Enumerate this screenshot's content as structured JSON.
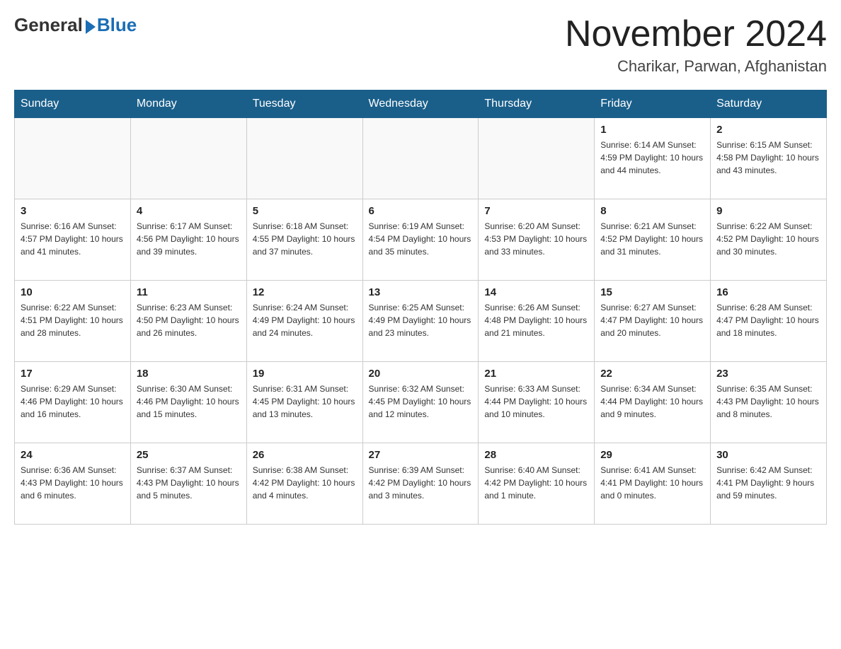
{
  "header": {
    "logo_general": "General",
    "logo_blue": "Blue",
    "month_title": "November 2024",
    "location": "Charikar, Parwan, Afghanistan"
  },
  "weekdays": [
    "Sunday",
    "Monday",
    "Tuesday",
    "Wednesday",
    "Thursday",
    "Friday",
    "Saturday"
  ],
  "weeks": [
    [
      {
        "day": "",
        "info": ""
      },
      {
        "day": "",
        "info": ""
      },
      {
        "day": "",
        "info": ""
      },
      {
        "day": "",
        "info": ""
      },
      {
        "day": "",
        "info": ""
      },
      {
        "day": "1",
        "info": "Sunrise: 6:14 AM\nSunset: 4:59 PM\nDaylight: 10 hours and 44 minutes."
      },
      {
        "day": "2",
        "info": "Sunrise: 6:15 AM\nSunset: 4:58 PM\nDaylight: 10 hours and 43 minutes."
      }
    ],
    [
      {
        "day": "3",
        "info": "Sunrise: 6:16 AM\nSunset: 4:57 PM\nDaylight: 10 hours and 41 minutes."
      },
      {
        "day": "4",
        "info": "Sunrise: 6:17 AM\nSunset: 4:56 PM\nDaylight: 10 hours and 39 minutes."
      },
      {
        "day": "5",
        "info": "Sunrise: 6:18 AM\nSunset: 4:55 PM\nDaylight: 10 hours and 37 minutes."
      },
      {
        "day": "6",
        "info": "Sunrise: 6:19 AM\nSunset: 4:54 PM\nDaylight: 10 hours and 35 minutes."
      },
      {
        "day": "7",
        "info": "Sunrise: 6:20 AM\nSunset: 4:53 PM\nDaylight: 10 hours and 33 minutes."
      },
      {
        "day": "8",
        "info": "Sunrise: 6:21 AM\nSunset: 4:52 PM\nDaylight: 10 hours and 31 minutes."
      },
      {
        "day": "9",
        "info": "Sunrise: 6:22 AM\nSunset: 4:52 PM\nDaylight: 10 hours and 30 minutes."
      }
    ],
    [
      {
        "day": "10",
        "info": "Sunrise: 6:22 AM\nSunset: 4:51 PM\nDaylight: 10 hours and 28 minutes."
      },
      {
        "day": "11",
        "info": "Sunrise: 6:23 AM\nSunset: 4:50 PM\nDaylight: 10 hours and 26 minutes."
      },
      {
        "day": "12",
        "info": "Sunrise: 6:24 AM\nSunset: 4:49 PM\nDaylight: 10 hours and 24 minutes."
      },
      {
        "day": "13",
        "info": "Sunrise: 6:25 AM\nSunset: 4:49 PM\nDaylight: 10 hours and 23 minutes."
      },
      {
        "day": "14",
        "info": "Sunrise: 6:26 AM\nSunset: 4:48 PM\nDaylight: 10 hours and 21 minutes."
      },
      {
        "day": "15",
        "info": "Sunrise: 6:27 AM\nSunset: 4:47 PM\nDaylight: 10 hours and 20 minutes."
      },
      {
        "day": "16",
        "info": "Sunrise: 6:28 AM\nSunset: 4:47 PM\nDaylight: 10 hours and 18 minutes."
      }
    ],
    [
      {
        "day": "17",
        "info": "Sunrise: 6:29 AM\nSunset: 4:46 PM\nDaylight: 10 hours and 16 minutes."
      },
      {
        "day": "18",
        "info": "Sunrise: 6:30 AM\nSunset: 4:46 PM\nDaylight: 10 hours and 15 minutes."
      },
      {
        "day": "19",
        "info": "Sunrise: 6:31 AM\nSunset: 4:45 PM\nDaylight: 10 hours and 13 minutes."
      },
      {
        "day": "20",
        "info": "Sunrise: 6:32 AM\nSunset: 4:45 PM\nDaylight: 10 hours and 12 minutes."
      },
      {
        "day": "21",
        "info": "Sunrise: 6:33 AM\nSunset: 4:44 PM\nDaylight: 10 hours and 10 minutes."
      },
      {
        "day": "22",
        "info": "Sunrise: 6:34 AM\nSunset: 4:44 PM\nDaylight: 10 hours and 9 minutes."
      },
      {
        "day": "23",
        "info": "Sunrise: 6:35 AM\nSunset: 4:43 PM\nDaylight: 10 hours and 8 minutes."
      }
    ],
    [
      {
        "day": "24",
        "info": "Sunrise: 6:36 AM\nSunset: 4:43 PM\nDaylight: 10 hours and 6 minutes."
      },
      {
        "day": "25",
        "info": "Sunrise: 6:37 AM\nSunset: 4:43 PM\nDaylight: 10 hours and 5 minutes."
      },
      {
        "day": "26",
        "info": "Sunrise: 6:38 AM\nSunset: 4:42 PM\nDaylight: 10 hours and 4 minutes."
      },
      {
        "day": "27",
        "info": "Sunrise: 6:39 AM\nSunset: 4:42 PM\nDaylight: 10 hours and 3 minutes."
      },
      {
        "day": "28",
        "info": "Sunrise: 6:40 AM\nSunset: 4:42 PM\nDaylight: 10 hours and 1 minute."
      },
      {
        "day": "29",
        "info": "Sunrise: 6:41 AM\nSunset: 4:41 PM\nDaylight: 10 hours and 0 minutes."
      },
      {
        "day": "30",
        "info": "Sunrise: 6:42 AM\nSunset: 4:41 PM\nDaylight: 9 hours and 59 minutes."
      }
    ]
  ]
}
